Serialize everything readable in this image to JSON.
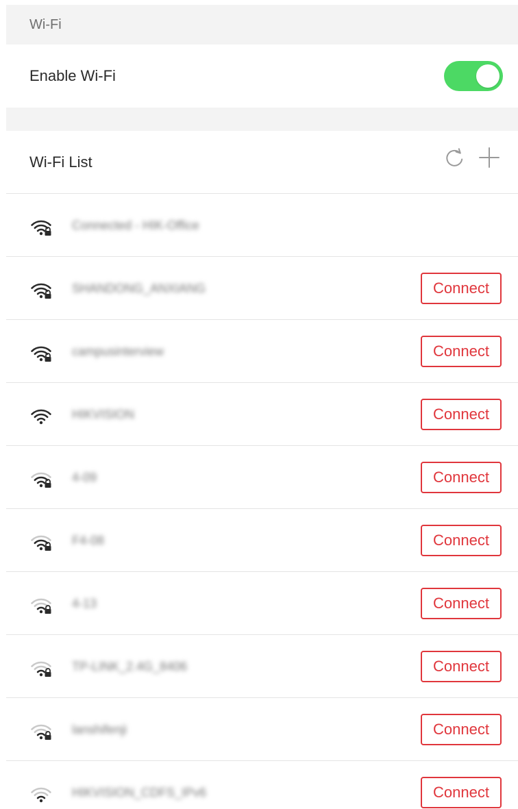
{
  "section": {
    "title": "Wi-Fi"
  },
  "enable": {
    "label": "Enable Wi-Fi",
    "enabled": true,
    "toggle_color": "#4cd964"
  },
  "list": {
    "title": "Wi-Fi List",
    "refresh_icon": "refresh-icon",
    "add_icon": "plus-icon"
  },
  "connect_label": "Connect",
  "accent_color": "#e0363c",
  "networks": [
    {
      "ssid": "Connected - HIK-Office",
      "signal": 4,
      "locked": true,
      "connected": true
    },
    {
      "ssid": "SHANDONG_ANXIANG",
      "signal": 4,
      "locked": true,
      "connected": false
    },
    {
      "ssid": "campusinterview",
      "signal": 4,
      "locked": true,
      "connected": false
    },
    {
      "ssid": "HIKVISION",
      "signal": 4,
      "locked": false,
      "connected": false
    },
    {
      "ssid": "4-09",
      "signal": 3,
      "locked": true,
      "connected": false
    },
    {
      "ssid": "F4-08",
      "signal": 3,
      "locked": true,
      "connected": false
    },
    {
      "ssid": "4-13",
      "signal": 2,
      "locked": true,
      "connected": false
    },
    {
      "ssid": "TP-LINK_2.4G_8406",
      "signal": 2,
      "locked": true,
      "connected": false
    },
    {
      "ssid": "lanshifenji",
      "signal": 2,
      "locked": true,
      "connected": false
    },
    {
      "ssid": "HIKVISION_CDFS_IPv6",
      "signal": 2,
      "locked": false,
      "connected": false
    }
  ]
}
